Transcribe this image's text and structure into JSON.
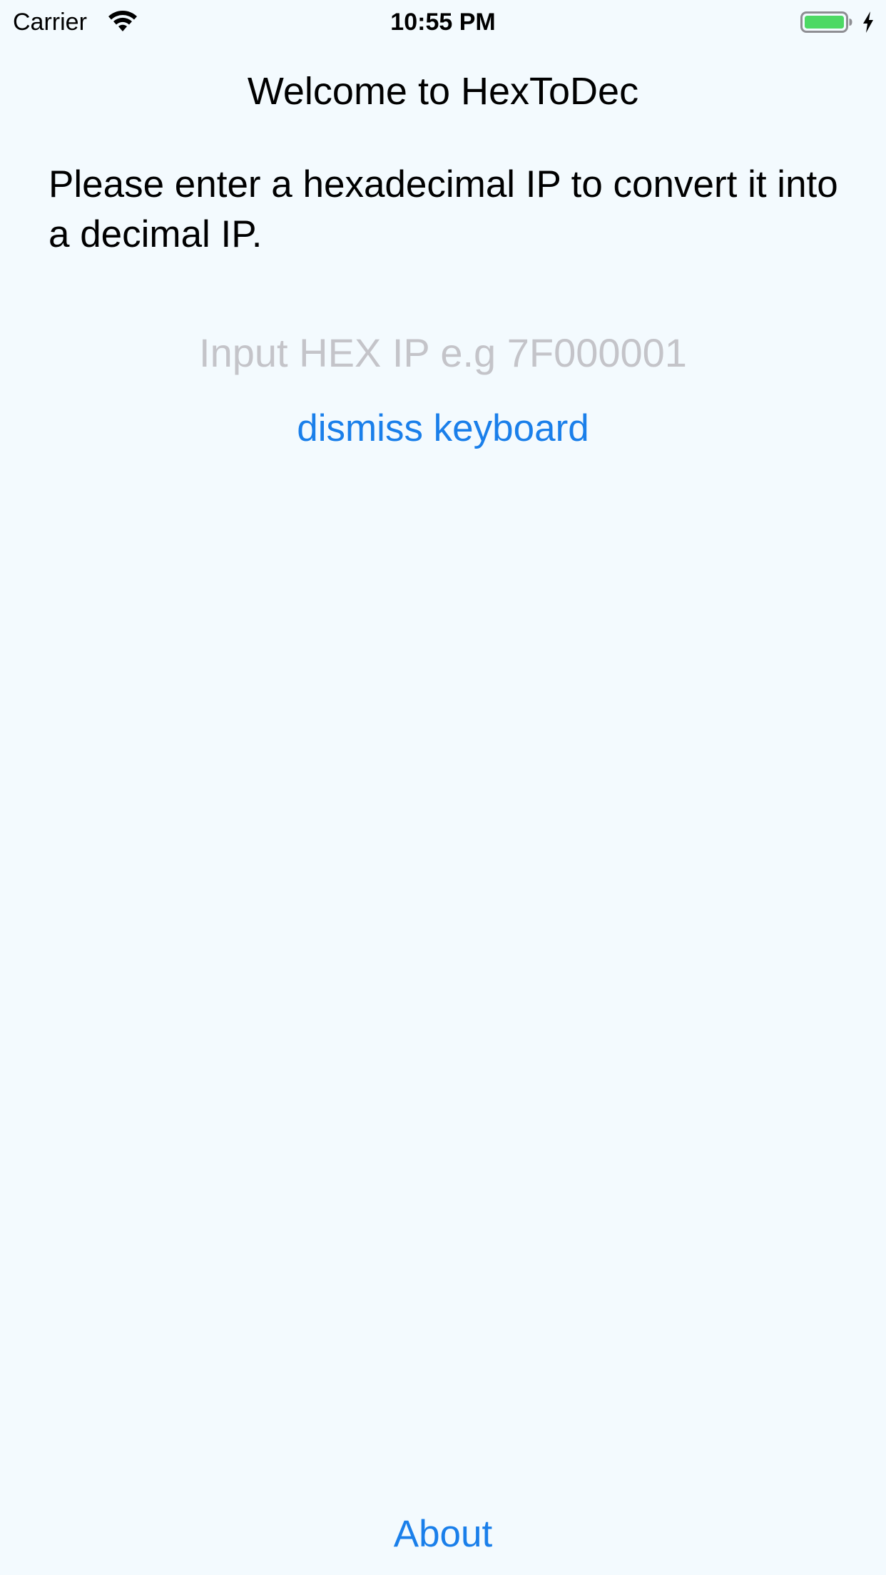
{
  "status_bar": {
    "carrier": "Carrier",
    "time": "10:55 PM",
    "wifi_icon": "wifi-icon",
    "battery_icon": "battery-icon",
    "charging_icon": "charging-bolt-icon",
    "battery_level": 1.0,
    "battery_color": "#4cd964"
  },
  "main": {
    "title": "Welcome to HexToDec",
    "instructions": "Please enter a hexadecimal IP to convert it into a decimal IP.",
    "input": {
      "value": "",
      "placeholder": "Input HEX IP e.g 7F000001"
    },
    "dismiss_label": "dismiss keyboard"
  },
  "footer": {
    "about_label": "About"
  },
  "colors": {
    "background": "#f3fafe",
    "accent": "#1a7fea",
    "placeholder": "#c4c4c9"
  }
}
